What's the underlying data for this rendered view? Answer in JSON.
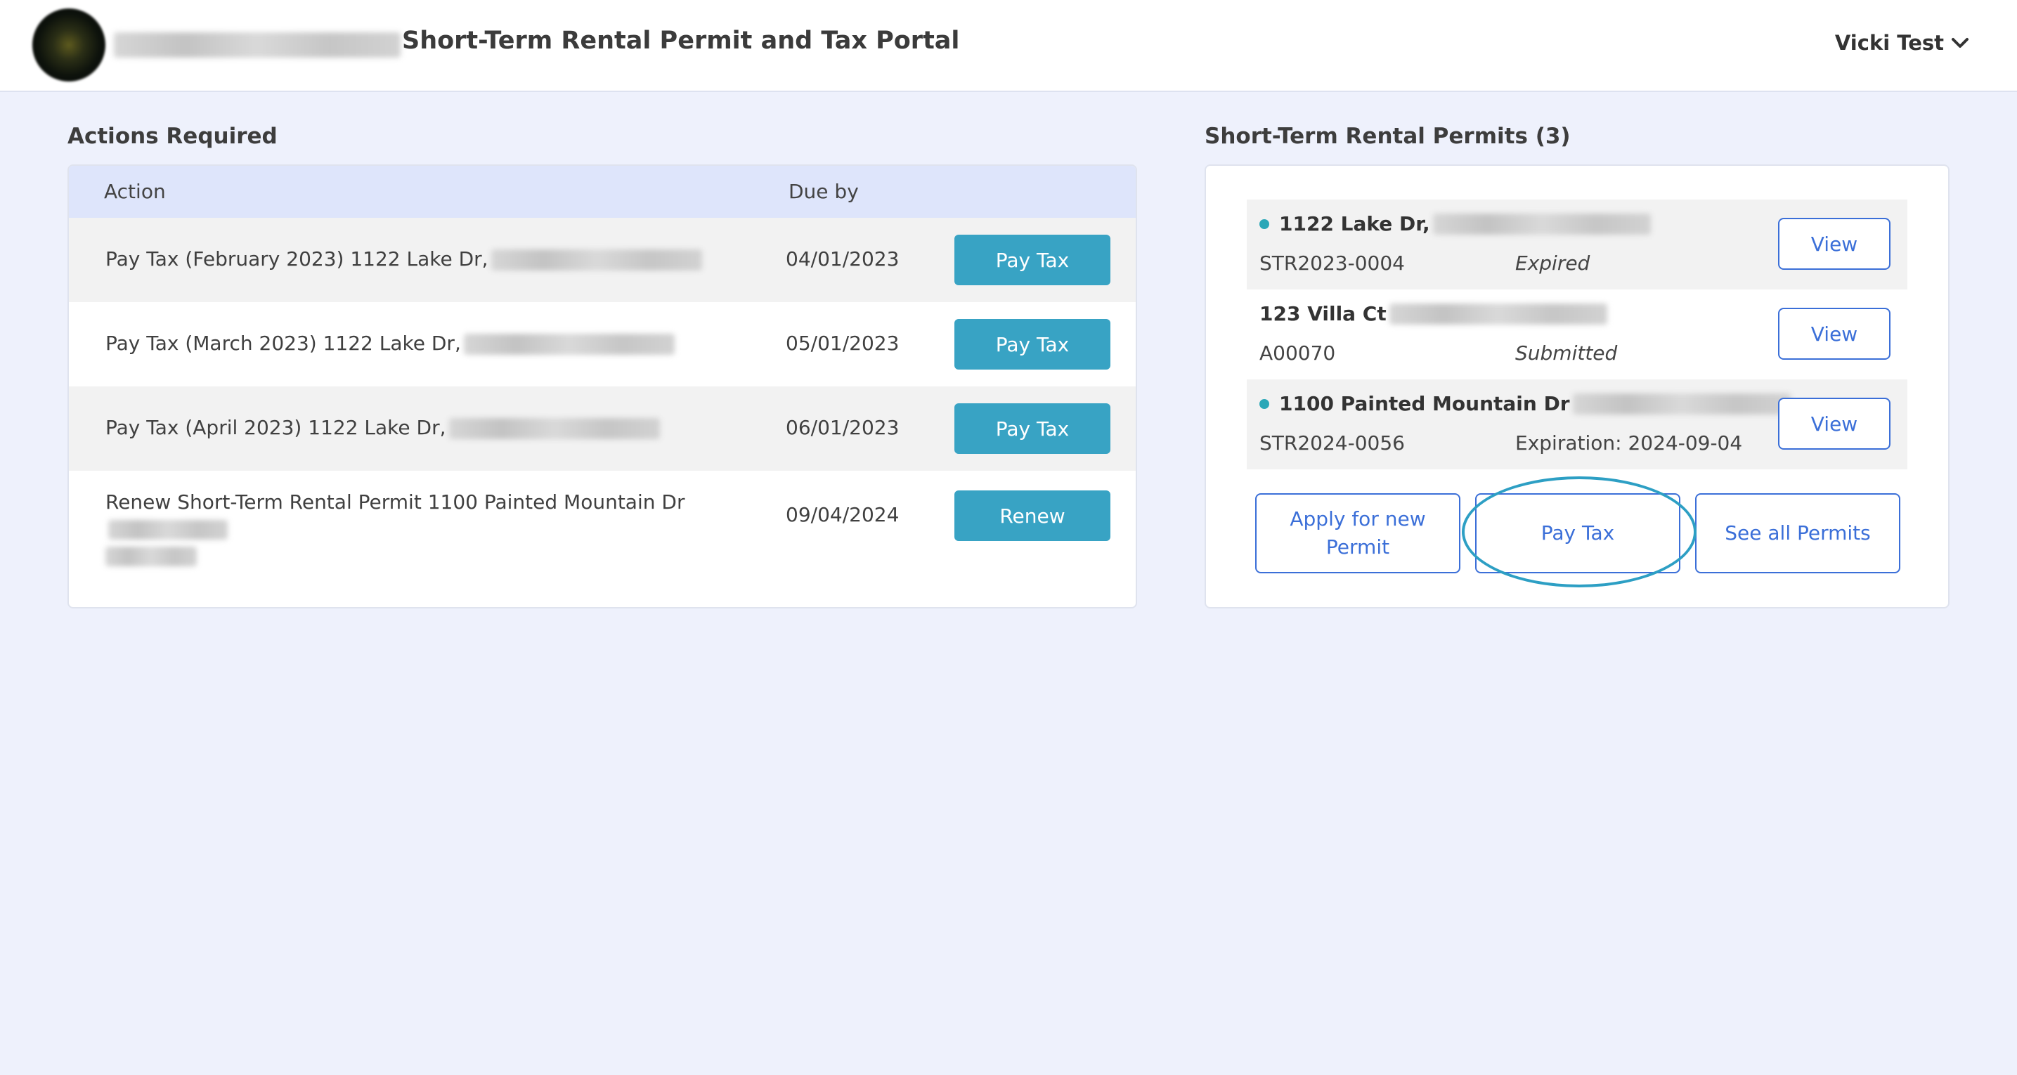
{
  "header": {
    "title": "Short-Term Rental Permit and Tax Portal",
    "user_name": "Vicki Test"
  },
  "actions": {
    "title": "Actions Required",
    "columns": {
      "action": "Action",
      "due": "Due by"
    },
    "rows": [
      {
        "text": "Pay Tax (February 2023) 1122 Lake Dr,",
        "due": "04/01/2023",
        "button": "Pay Tax"
      },
      {
        "text": "Pay Tax (March 2023) 1122 Lake Dr,",
        "due": "05/01/2023",
        "button": "Pay Tax"
      },
      {
        "text": "Pay Tax (April 2023) 1122 Lake Dr,",
        "due": "06/01/2023",
        "button": "Pay Tax"
      },
      {
        "text": "Renew Short-Term Rental Permit 1100 Painted Mountain Dr",
        "due": "09/04/2024",
        "button": "Renew"
      }
    ]
  },
  "permits": {
    "title": "Short-Term Rental Permits (3)",
    "items": [
      {
        "address": "1122 Lake Dr,",
        "number": "STR2023-0004",
        "status": "Expired",
        "button": "View"
      },
      {
        "address": "123 Villa Ct",
        "number": "A00070",
        "status": "Submitted",
        "button": "View"
      },
      {
        "address": "1100 Painted Mountain Dr",
        "number": "STR2024-0056",
        "status": "Expiration: 2024-09-04",
        "button": "View"
      }
    ],
    "buttons": {
      "apply_line1": "Apply for new",
      "apply_line2": "Permit",
      "pay_tax": "Pay Tax",
      "see_all": "See all Permits"
    }
  },
  "colors": {
    "accent": "#38a3c4",
    "link_blue": "#3b6fd8",
    "status_dot": "#2aa7b7",
    "background": "#eef1fc",
    "table_header": "#dee5fb"
  }
}
